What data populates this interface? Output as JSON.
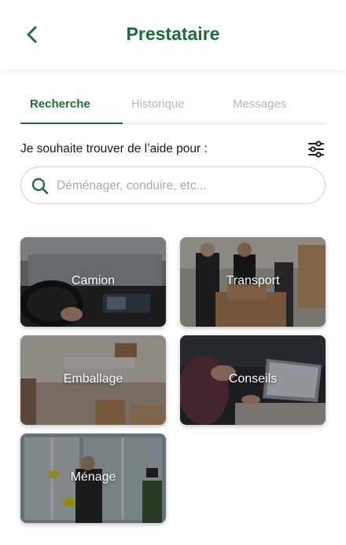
{
  "header": {
    "title": "Prestataire"
  },
  "tabs": [
    {
      "label": "Recherche",
      "active": true
    },
    {
      "label": "Historique",
      "active": false
    },
    {
      "label": "Messages",
      "active": false
    }
  ],
  "search": {
    "prompt": "Je souhaite trouver de l’aide pour :",
    "placeholder": "Déménager, conduire, etc..."
  },
  "categories": [
    {
      "label": "Camion",
      "image": "car-dashboard-photo"
    },
    {
      "label": "Transport",
      "image": "delivery-people-boxes-photo"
    },
    {
      "label": "Emballage",
      "image": "room-with-boxes-photo"
    },
    {
      "label": "Conseils",
      "image": "laptop-meeting-photo"
    },
    {
      "label": "Ménage",
      "image": "window-cleaning-photo"
    }
  ],
  "colors": {
    "accent": "#1e6b3c",
    "inactive_tab": "#b8b8b8",
    "card_border": "#c8a97e"
  }
}
